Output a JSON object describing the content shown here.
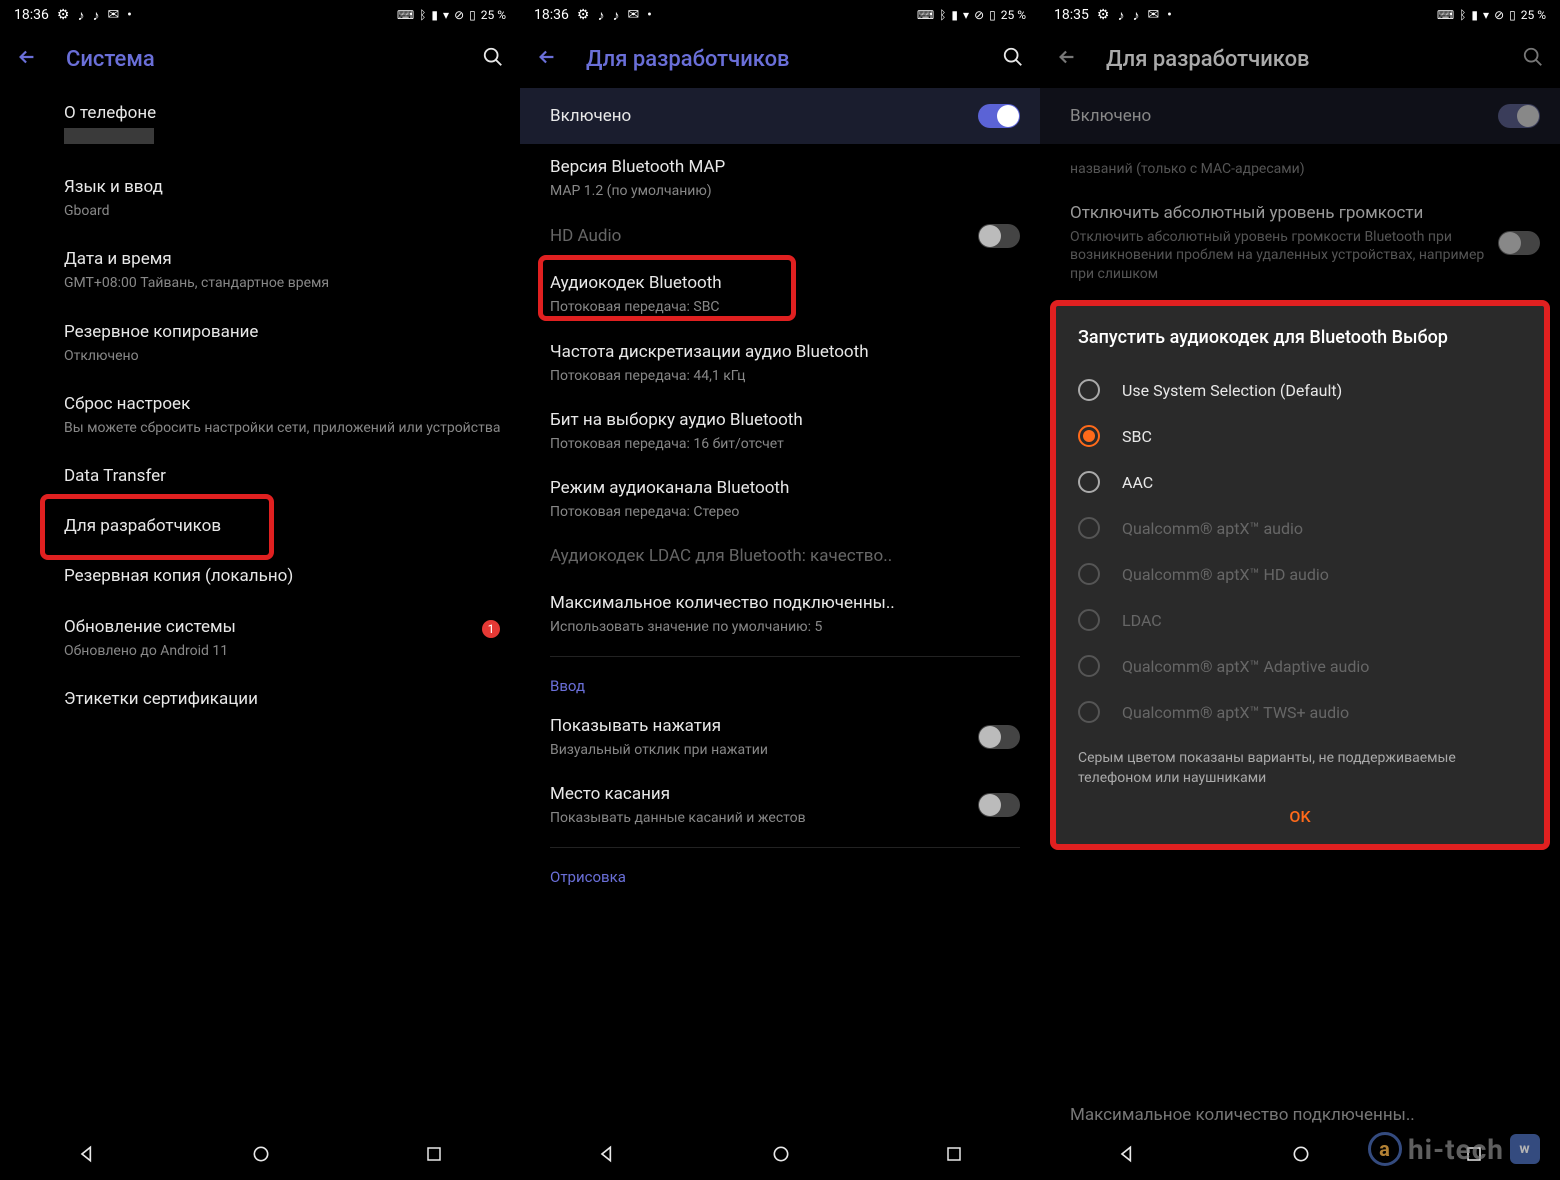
{
  "status": {
    "time_a": "18:36",
    "time_b": "18:36",
    "time_c": "18:35",
    "battery": "25 %"
  },
  "screen1": {
    "title": "Система",
    "items": {
      "about": {
        "title": "О телефоне"
      },
      "lang": {
        "title": "Язык и ввод",
        "sub": "Gboard"
      },
      "date": {
        "title": "Дата и время",
        "sub": "GMT+08:00 Тайвань, стандартное время"
      },
      "backup_cloud": {
        "title": "Резервное копирование",
        "sub": "Отключено"
      },
      "reset": {
        "title": "Сброс настроек",
        "sub": "Вы можете сбросить настройки сети, приложений или устройства"
      },
      "transfer": {
        "title": "Data Transfer"
      },
      "dev": {
        "title": "Для разработчиков"
      },
      "backup_local": {
        "title": "Резервная копия (локально)"
      },
      "update": {
        "title": "Обновление системы",
        "sub": "Обновлено до Android 11",
        "badge": "1"
      },
      "cert": {
        "title": "Этикетки сертификации"
      }
    }
  },
  "screen2": {
    "title": "Для разработчиков",
    "enabled": "Включено",
    "items": {
      "map": {
        "title": "Версия Bluetooth MAP",
        "sub": "MAP 1.2 (по умолчанию)"
      },
      "hd": {
        "title": "HD Audio"
      },
      "codec": {
        "title": "Аудиокодек Bluetooth",
        "sub": "Потоковая передача: SBC"
      },
      "sample": {
        "title": "Частота дискретизации аудио Bluetooth",
        "sub": "Потоковая передача: 44,1 кГц"
      },
      "bits": {
        "title": "Бит на выборку аудио Bluetooth",
        "sub": "Потоковая передача: 16 бит/отсчет"
      },
      "channel": {
        "title": "Режим аудиоканала Bluetooth",
        "sub": "Потоковая передача: Стерео"
      },
      "ldac": {
        "title": "Аудиокодек LDAC для Bluetooth: качество.."
      },
      "max": {
        "title": "Максимальное количество подключенны..",
        "sub": "Использовать значение по умолчанию: 5"
      },
      "input_header": "Ввод",
      "taps": {
        "title": "Показывать нажатия",
        "sub": "Визуальный отклик при нажатии"
      },
      "touch": {
        "title": "Место касания",
        "sub": "Показывать данные касаний и жестов"
      },
      "draw_header": "Отрисовка"
    }
  },
  "screen3": {
    "title": "Для разработчиков",
    "enabled": "Включено",
    "bg_items": {
      "noname": {
        "sub": "названий (только с MAC-адресами)"
      },
      "absvol": {
        "title": "Отключить абсолютный уровень громкости",
        "sub": "Отключить абсолютный уровень громкости Bluetooth при возникновении проблем на удаленных устройствах, например при слишком"
      },
      "max": {
        "title": "Максимальное количество подключенны.."
      }
    },
    "dialog": {
      "title": "Запустить аудиокодек для Bluetooth Выбор",
      "options": [
        {
          "label": "Use System Selection (Default)",
          "state": "unselected"
        },
        {
          "label": "SBC",
          "state": "selected"
        },
        {
          "label": "AAC",
          "state": "unselected"
        },
        {
          "label": "Qualcomm® aptX™ audio",
          "state": "disabled"
        },
        {
          "label": "Qualcomm® aptX™ HD audio",
          "state": "disabled"
        },
        {
          "label": "LDAC",
          "state": "disabled"
        },
        {
          "label": "Qualcomm® aptX™ Adaptive audio",
          "state": "disabled"
        },
        {
          "label": "Qualcomm® aptX™ TWS+ audio",
          "state": "disabled"
        }
      ],
      "hint": "Серым цветом показаны варианты, не поддерживаемые телефоном или наушниками",
      "ok": "OK"
    }
  },
  "watermark": {
    "text": "hi-tech"
  }
}
